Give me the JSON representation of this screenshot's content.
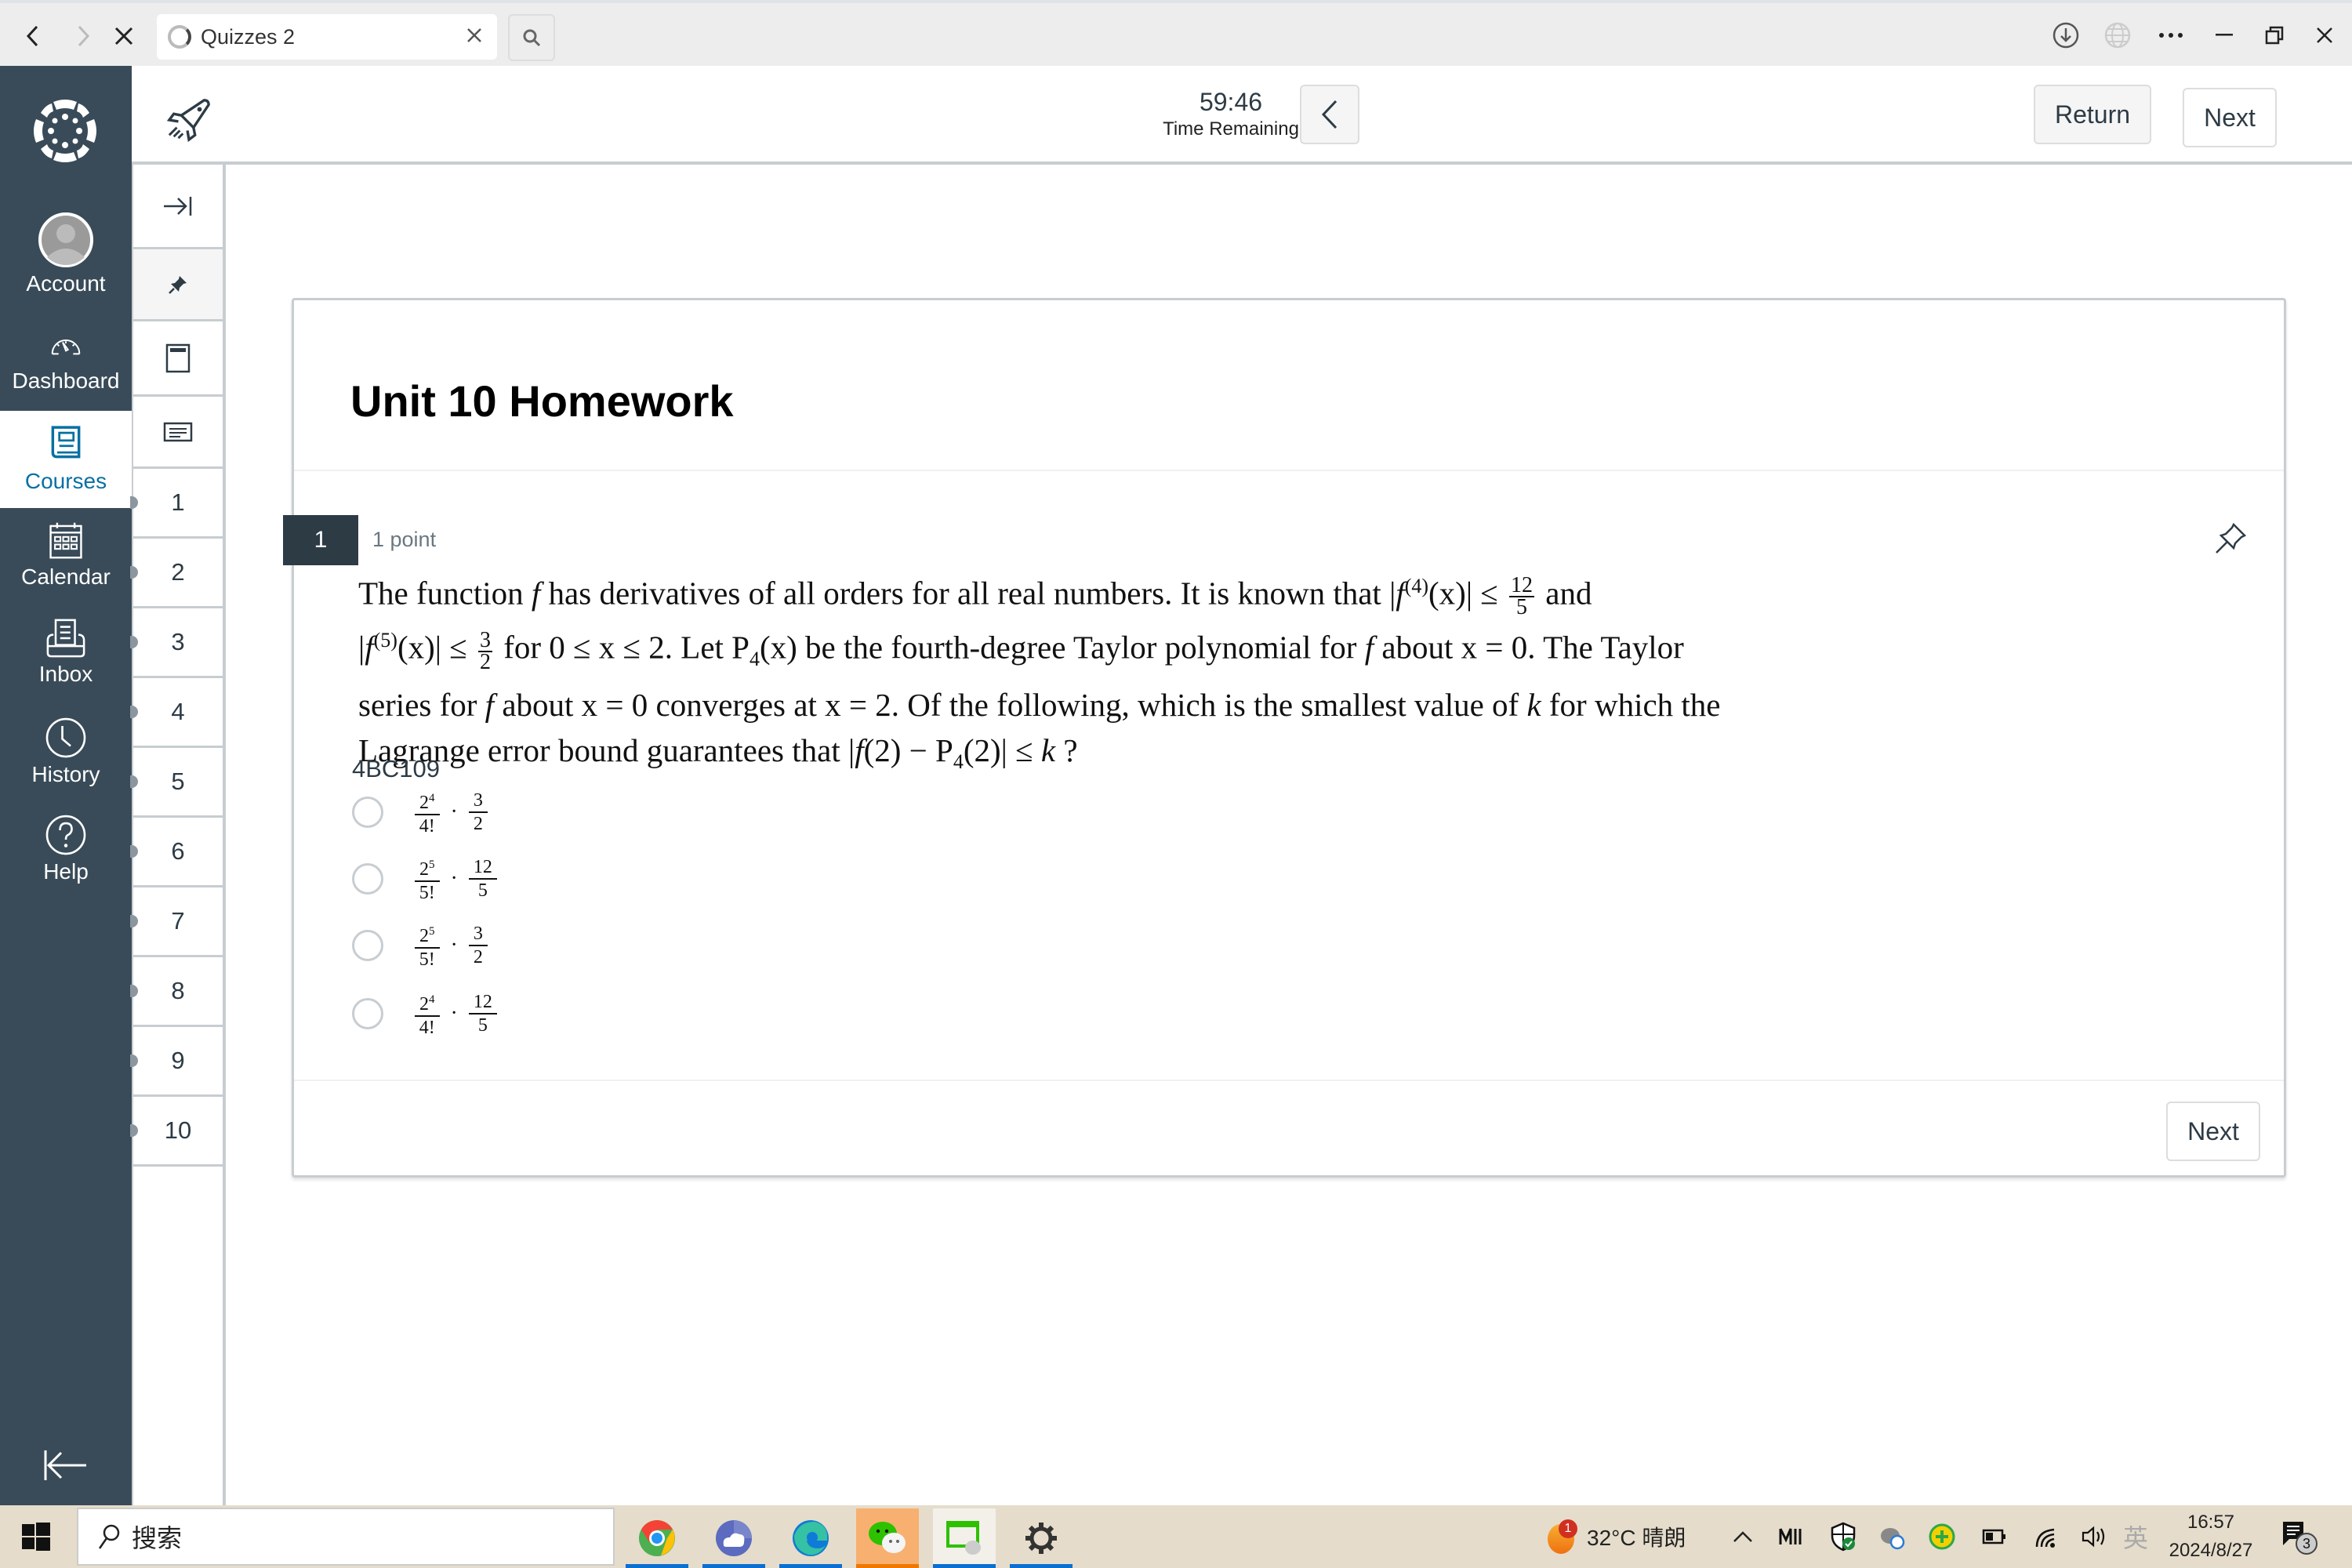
{
  "browser": {
    "tab_title": "Quizzes 2",
    "back_icon": "chevron-left-icon",
    "forward_icon": "chevron-right-icon",
    "stop_icon": "close-icon",
    "window_controls": [
      "download-icon",
      "globe-icon",
      "more-icon",
      "minimize-icon",
      "restore-icon",
      "close-icon"
    ]
  },
  "global_nav": {
    "items": [
      {
        "label": "Account",
        "icon": "avatar-icon",
        "active": false
      },
      {
        "label": "Dashboard",
        "icon": "dashboard-icon",
        "active": false
      },
      {
        "label": "Courses",
        "icon": "courses-icon",
        "active": true
      },
      {
        "label": "Calendar",
        "icon": "calendar-icon",
        "active": false
      },
      {
        "label": "Inbox",
        "icon": "inbox-icon",
        "active": false
      },
      {
        "label": "History",
        "icon": "clock-icon",
        "active": false
      },
      {
        "label": "Help",
        "icon": "help-icon",
        "active": false
      }
    ],
    "accent": "#0770a3",
    "background": "#394b58"
  },
  "header": {
    "timer": "59:46",
    "timer_label": "Time Remaining",
    "return_label": "Return",
    "next_label": "Next"
  },
  "question_nav": {
    "numbers": [
      "1",
      "2",
      "3",
      "4",
      "5",
      "6",
      "7",
      "8",
      "9",
      "10"
    ]
  },
  "quiz": {
    "title": "Unit 10 Homework",
    "question": {
      "number": "1",
      "points": "1 point",
      "text_parts": {
        "l1a": "The function ",
        "l1b": " has derivatives of all orders for all real numbers. It is known that |",
        "l1c": "(x)| ≤ ",
        "l1d": " and",
        "l2a": "|",
        "l2b": "(x)| ≤ ",
        "l2c": " for 0 ≤ x ≤ 2. Let P",
        "l2d": "(x) be the fourth-degree Taylor polynomial for ",
        "l2e": " about x = 0. The Taylor",
        "l3a": "series for ",
        "l3b": " about x = 0 converges at x = 2. Of the following, which is the smallest value of ",
        "l3c": " for which the",
        "l4a": "Lagrange error bound guarantees that |",
        "l4b": "(2) − P",
        "l4c": "(2)| ≤ ",
        "l4d": " ?",
        "f": "f",
        "k": "k",
        "sup4": "(4)",
        "sup5": "(5)",
        "sub4": "4",
        "frac1_num": "12",
        "frac1_den": "5",
        "frac2_num": "3",
        "frac2_den": "2"
      },
      "code": "4BC109",
      "options": [
        {
          "a_base": "2",
          "a_exp": "4",
          "a_den": "4!",
          "b_num": "3",
          "b_den": "2",
          "dot": "·"
        },
        {
          "a_base": "2",
          "a_exp": "5",
          "a_den": "5!",
          "b_num": "12",
          "b_den": "5",
          "dot": "·"
        },
        {
          "a_base": "2",
          "a_exp": "5",
          "a_den": "5!",
          "b_num": "3",
          "b_den": "2",
          "dot": "·"
        },
        {
          "a_base": "2",
          "a_exp": "4",
          "a_den": "4!",
          "b_num": "12",
          "b_den": "5",
          "dot": "·"
        }
      ]
    },
    "footer_next_label": "Next"
  },
  "taskbar": {
    "search_placeholder": "搜索",
    "apps": [
      "chrome-icon",
      "cloud-app-icon",
      "edge-icon",
      "wechat-icon",
      "wechat-files-icon",
      "settings-icon"
    ],
    "weather": "32°C 晴朗",
    "weather_badge": "1",
    "ime": "英",
    "time": "16:57",
    "date": "2024/8/27",
    "notification_count": "3"
  }
}
